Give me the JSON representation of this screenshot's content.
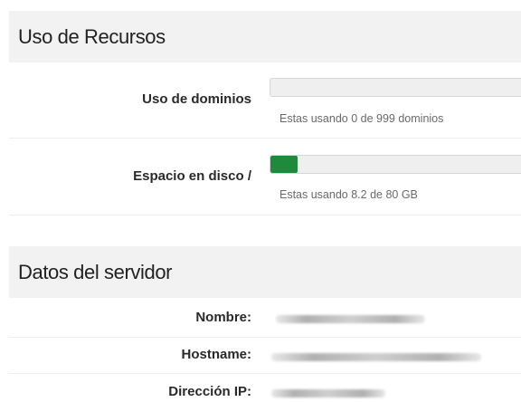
{
  "resources": {
    "title": "Uso de Recursos",
    "domains": {
      "label": "Uso de dominios",
      "note": "Estas usando 0 de 999 dominios",
      "used": 0,
      "total": 999,
      "fill_fraction": 0.0
    },
    "disk": {
      "label": "Espacio en disco /",
      "note": "Estas usando 8.2 de 80 GB",
      "used": 8.2,
      "total": 80,
      "fill_fraction": 0.1025,
      "fill_color": "#1e8a3c"
    }
  },
  "server": {
    "title": "Datos del servidor",
    "rows": [
      {
        "label": "Nombre:"
      },
      {
        "label": "Hostname:"
      },
      {
        "label": "Dirección IP:"
      }
    ]
  }
}
